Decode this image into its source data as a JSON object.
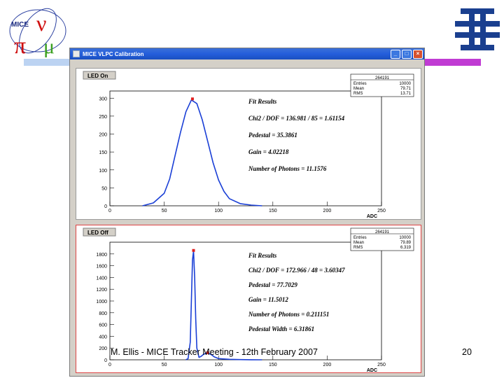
{
  "window": {
    "title": "MICE VLPC Calibration",
    "buttons": [
      "_",
      "□",
      "×"
    ]
  },
  "colors": {
    "hist": "#000000",
    "fit": "#1a3fd6",
    "peak_marker": "#e02020",
    "band_left": "#bcd3f2",
    "band_right": "#c03bd3"
  },
  "icons": [
    "mice-logo-icon",
    "fermilab-logo-icon",
    "window-icon"
  ],
  "panels": [
    {
      "button_label": "LED On",
      "stats": {
        "title": "264191",
        "rows": [
          [
            "Entries",
            "10000"
          ],
          [
            "Mean",
            "79.71"
          ],
          [
            "RMS",
            "13.71"
          ]
        ]
      },
      "fit_title": "Fit Results",
      "fit_lines": [
        "Chi2 / DOF = 136.981 / 85 = 1.61154",
        "Pedestal = 35.3861",
        "Gain = 4.02218",
        "Number of Photons = 11.1576"
      ],
      "chart_data": {
        "type": "line",
        "xlim": [
          0,
          250
        ],
        "ylim": [
          0,
          320
        ],
        "x_ticks": [
          0,
          50,
          100,
          150,
          200,
          250
        ],
        "y_ticks": [
          0,
          50,
          100,
          150,
          200,
          250,
          300
        ],
        "xlabel": "ADC",
        "series": [
          {
            "x": [
              30,
              40,
              50,
              55,
              60,
              65,
              70,
              75,
              80,
              85,
              90,
              95,
              100,
              105,
              110,
              120,
              130,
              140
            ],
            "y": [
              0,
              8,
              35,
              75,
              140,
              205,
              262,
              295,
              285,
              240,
              180,
              120,
              72,
              40,
              20,
              6,
              2,
              0
            ]
          }
        ],
        "peak": [
          76,
          298
        ]
      }
    },
    {
      "button_label": "LED Off",
      "stats": {
        "title": "264191",
        "rows": [
          [
            "Entries",
            "10000"
          ],
          [
            "Mean",
            "79.89"
          ],
          [
            "RMS",
            "6.319"
          ]
        ]
      },
      "fit_title": "Fit Results",
      "fit_lines": [
        "Chi2 / DOF = 172.966 / 48 = 3.60347",
        "Pedestal = 77.7029",
        "Gain = 11.5012",
        "Number of Photons = 0.211151",
        "Pedestal Width = 6.31861"
      ],
      "chart_data": {
        "type": "line",
        "xlim": [
          0,
          250
        ],
        "ylim": [
          0,
          2000
        ],
        "x_ticks": [
          0,
          50,
          100,
          150,
          200,
          250
        ],
        "y_ticks": [
          0,
          200,
          400,
          600,
          800,
          1000,
          1200,
          1400,
          1600,
          1800
        ],
        "xlabel": "ADC",
        "series": [
          {
            "x": [
              70,
              72,
              74,
              75,
              76,
              77,
              78,
              79,
              80,
              82,
              84,
              86,
              88,
              90,
              92,
              94,
              96,
              100,
              110,
              120,
              130,
              140
            ],
            "y": [
              0,
              20,
              300,
              1000,
              1700,
              1850,
              1400,
              700,
              200,
              40,
              60,
              90,
              110,
              120,
              100,
              80,
              50,
              20,
              8,
              3,
              1,
              0
            ]
          }
        ],
        "peak": [
          77,
          1860
        ],
        "peak2": [
          90,
          120
        ]
      }
    }
  ],
  "footer": "M. Ellis - MICE Tracker Meeting - 12th February 2007",
  "slide_number": "20"
}
